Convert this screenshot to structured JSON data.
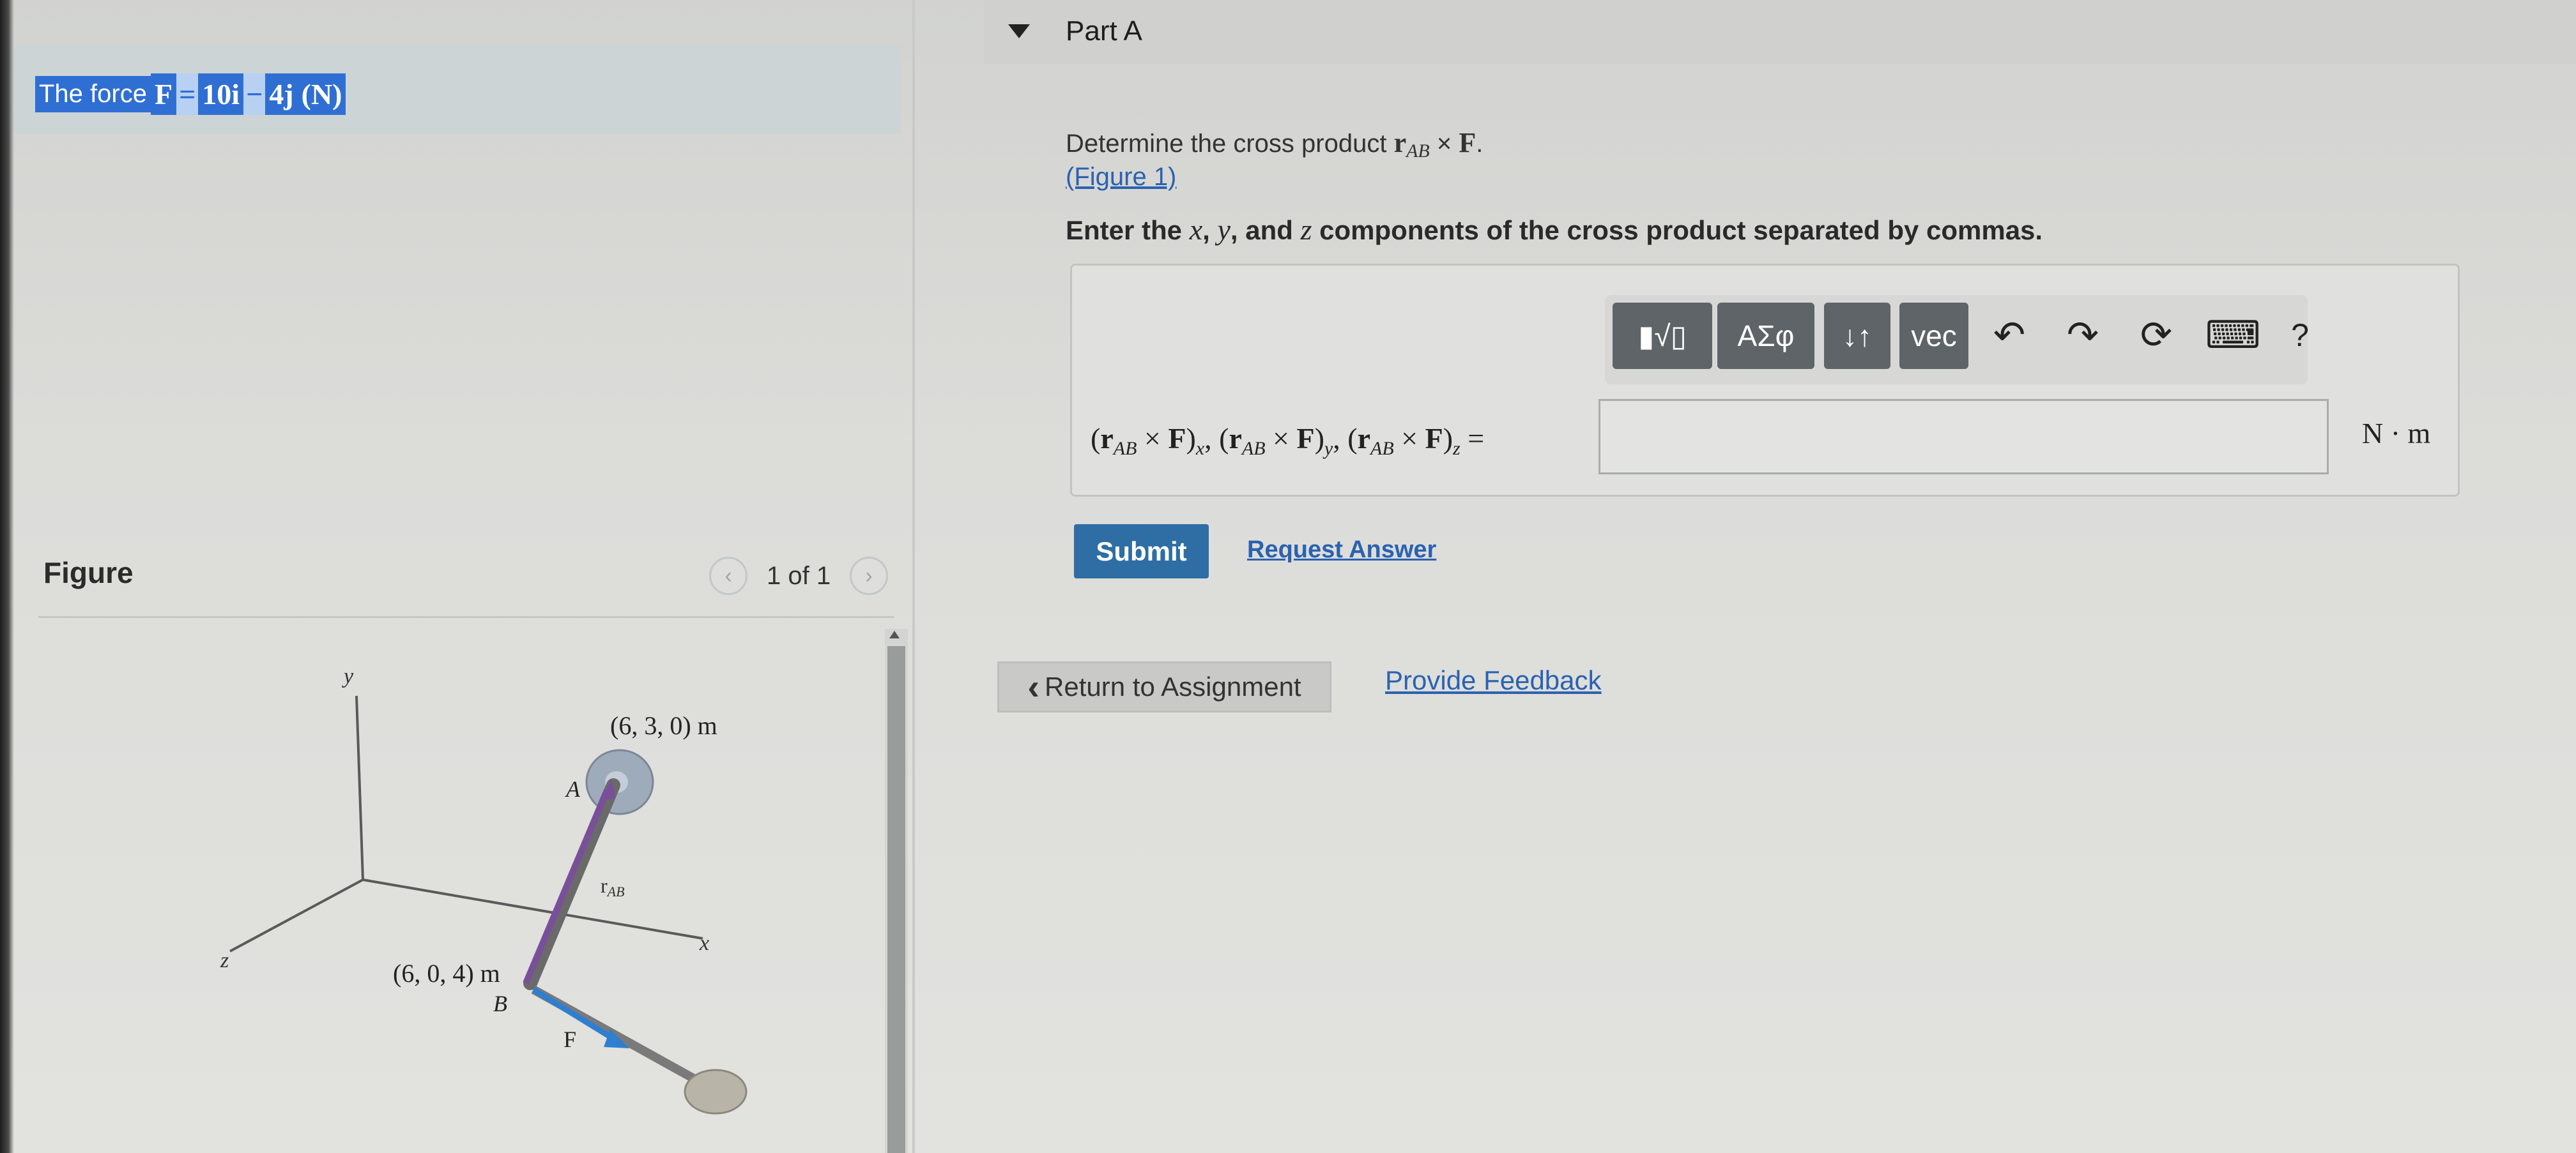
{
  "intro": {
    "prefix": "The force",
    "F": "F",
    "eq": "=",
    "term1": "10i",
    "minus": "−",
    "term2": "4j",
    "unit": "(N)"
  },
  "figure": {
    "title": "Figure",
    "pager_text": "1 of 1",
    "prev_icon": "chevron-left-icon",
    "next_icon": "chevron-right-icon",
    "labels": {
      "y": "y",
      "z": "z",
      "x": "x",
      "point_a_coords": "(6, 3, 0) m",
      "point_a": "A",
      "r_label": "r",
      "r_sub": "AB",
      "point_b_coords": "(6, 0, 4) m",
      "point_b": "B",
      "force": "F"
    },
    "colors": {
      "rod": "#7a4f9a",
      "force_arrow": "#2f7fd0",
      "disk": "#9aa8b8"
    }
  },
  "part": {
    "title": "Part A",
    "question_prefix": "Determine the cross product",
    "question_r": "r",
    "question_sub": "AB",
    "question_times": "×",
    "question_F": "F",
    "question_suffix": ".",
    "figure_link": "(Figure 1)",
    "instruction_prefix": "Enter the",
    "instruction_x": "x",
    "instruction_comma1": ",",
    "instruction_y": "y",
    "instruction_and": ", and",
    "instruction_z": "z",
    "instruction_suffix": "components of the cross product separated by commas."
  },
  "toolbar": {
    "template_label": "▮√▯",
    "greek_label": "ΑΣφ",
    "arrows_label": "↓↑",
    "vec_label": "vec",
    "undo_icon": "↶",
    "redo_icon": "↷",
    "reset_icon": "⟳",
    "keyboard_icon": "⌨",
    "help_label": "?"
  },
  "answer": {
    "equation": {
      "open": "(",
      "r": "r",
      "sub": "AB",
      "times": " × ",
      "F": "F",
      "close": ")",
      "sx": "x",
      "sy": "y",
      "sz": "z",
      "sep": ", ",
      "equals": " ="
    },
    "input_value": "",
    "unit": "N · m"
  },
  "actions": {
    "submit": "Submit",
    "request_answer": "Request Answer",
    "return_label": "Return to Assignment",
    "return_icon": "‹",
    "feedback": "Provide Feedback"
  }
}
